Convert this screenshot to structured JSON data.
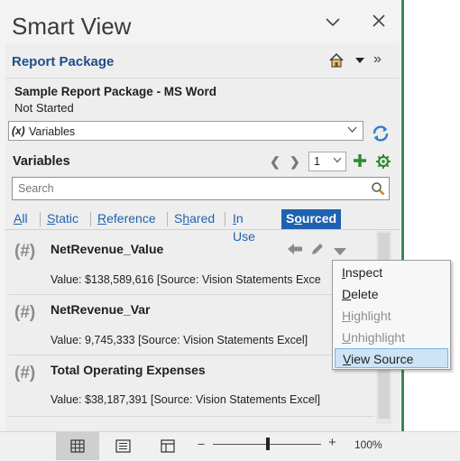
{
  "pane": {
    "title": "Smart View",
    "collapse_icon": "chevron-down-icon",
    "close_icon": "close-icon"
  },
  "report_package": {
    "link_label": "Report Package",
    "name": "Sample Report Package - MS Word",
    "status": "Not Started"
  },
  "combo": {
    "prefix": "(x)",
    "value": "Variables"
  },
  "variables": {
    "title": "Variables",
    "page": "1",
    "search_placeholder": "Search"
  },
  "tabs": [
    {
      "label": "All",
      "underline": "A",
      "rest": "ll"
    },
    {
      "label": "Static",
      "underline": "S",
      "rest": "tatic"
    },
    {
      "label": "Reference",
      "underline": "R",
      "rest": "eference"
    },
    {
      "label": "Shared",
      "underline": "h",
      "pre": "S",
      "rest": "ared"
    },
    {
      "label": "In Use",
      "underline": "I",
      "rest": "n Use"
    },
    {
      "label": "Sourced",
      "underline": "o",
      "pre": "S",
      "rest": "urced",
      "active": true
    }
  ],
  "rows": [
    {
      "icon": "(#)",
      "name": "NetRevenue_Value",
      "value": "Value:  $138,589,616  [Source: Vision Statements Exce"
    },
    {
      "icon": "(#)",
      "name": "NetRevenue_Var",
      "value": "Value:  9,745,333  [Source: Vision Statements Excel]"
    },
    {
      "icon": "(#)",
      "name": "Total Operating Expenses",
      "value": "Value:  $38,187,391  [Source: Vision Statements Excel]"
    }
  ],
  "context_menu": [
    {
      "label": "Inspect",
      "ul": "I",
      "rest": "nspect",
      "state": "normal"
    },
    {
      "label": "Delete",
      "ul": "D",
      "rest": "elete",
      "state": "normal"
    },
    {
      "label": "Highlight",
      "ul": "H",
      "rest": "ighlight",
      "state": "disabled"
    },
    {
      "label": "Unhighlight",
      "ul": "U",
      "rest": "nhighlight",
      "state": "disabled"
    },
    {
      "label": "View Source",
      "ul": "V",
      "rest": "iew Source",
      "state": "highlighted"
    }
  ],
  "status_bar": {
    "zoom_minus": "−",
    "zoom_plus": "+",
    "zoom": "100%"
  },
  "colors": {
    "accent": "#1f62b0",
    "link": "#1f4e8c",
    "add_green": "#2e8b2e",
    "menu_highlight": "#cce4f7"
  }
}
